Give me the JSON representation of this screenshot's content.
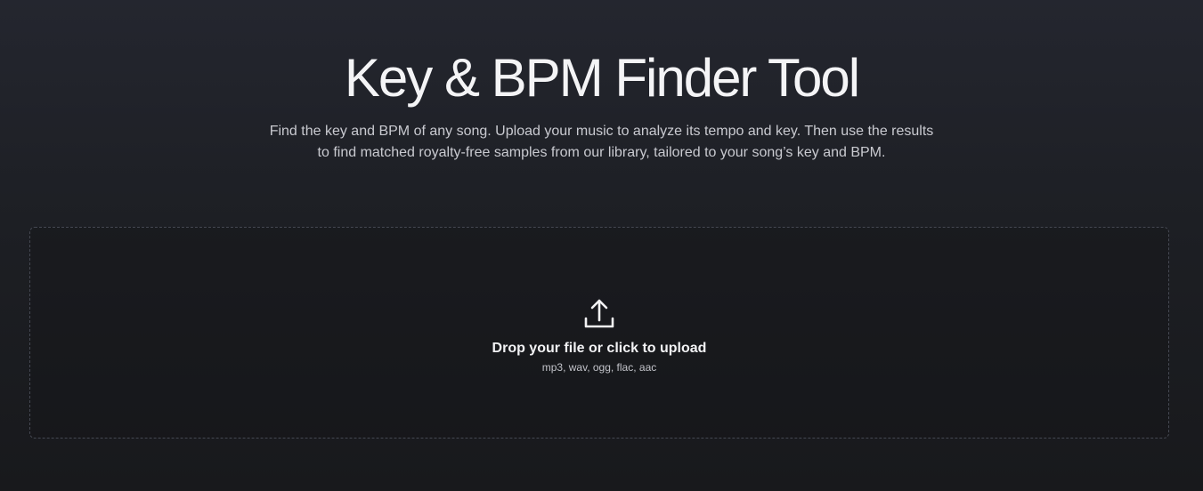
{
  "hero": {
    "title": "Key & BPM Finder Tool",
    "subtitle": "Find the key and BPM of any song. Upload your music to analyze its tempo and key. Then use the results to find matched royalty-free samples from our library, tailored to your song’s key and BPM."
  },
  "upload": {
    "icon": "upload-icon",
    "label": "Drop your file or click to upload",
    "formats": "mp3, wav, ogg, flac, aac"
  }
}
